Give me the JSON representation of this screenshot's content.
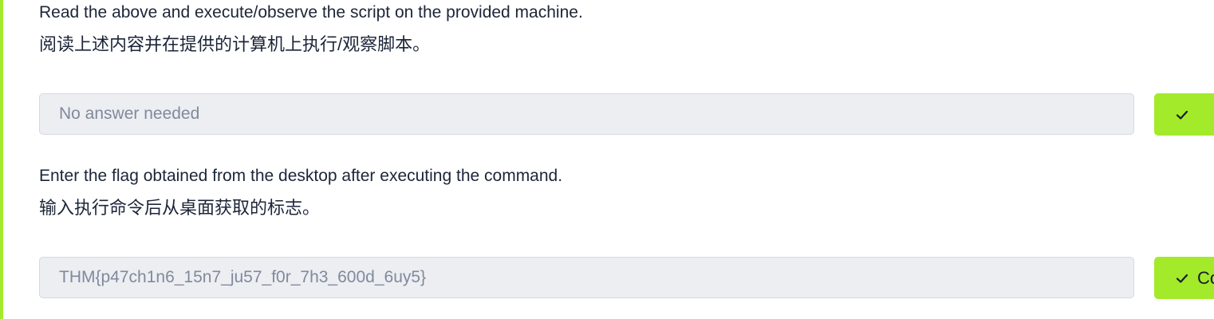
{
  "colors": {
    "accent": "#a3ea2a",
    "text": "#1c2538",
    "input_bg": "#eceef2",
    "input_text": "#808a9c"
  },
  "questions": [
    {
      "text_en": "Read the above and execute/observe the script on the provided machine.",
      "text_zh": "阅读上述内容并在提供的计算机上执行/观察脚本。",
      "answer_placeholder": "No answer needed",
      "answer_value": "",
      "submit_label": "",
      "submit_icon": "check-icon"
    },
    {
      "text_en": "Enter the flag obtained from the desktop after executing the command.",
      "text_zh": "输入执行命令后从桌面获取的标志。",
      "answer_placeholder": "",
      "answer_value": "THM{p47ch1n6_15n7_ju57_f0r_7h3_600d_6uy5}",
      "submit_label": "Co",
      "submit_icon": "check-icon"
    }
  ]
}
